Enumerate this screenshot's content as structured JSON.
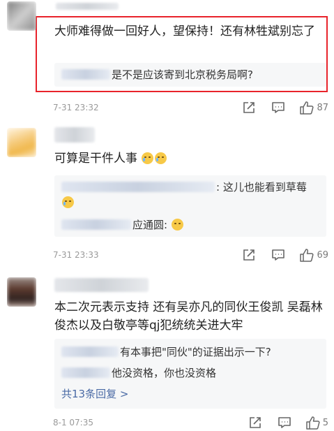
{
  "comments": [
    {
      "text": "大师难得做一回好人，望保持！还有林牲斌别忘了",
      "replies": [
        {
          "suffix": "是不是应该寄到北京税务局啊?"
        }
      ],
      "time": "7-31 23:32",
      "likes": "87"
    },
    {
      "text": "可算是干件人事",
      "replies": [
        {
          "suffix": ": 这儿也能看到草莓"
        },
        {
          "suffix": "应通圆: "
        }
      ],
      "time": "7-31 23:33",
      "likes": "69"
    },
    {
      "text": "本二次元表示支持 还有吴亦凡的同伙王俊凯 吴磊林俊杰以及白敬亭等qj犯统统关进大牢",
      "replies": [
        {
          "suffix": "有本事把\"同伙\"的证据出示一下?"
        },
        {
          "suffix": "他没资格，你也没资格"
        }
      ],
      "more_replies": "共13条回复 >",
      "time": "8-1 07:35",
      "likes": "5"
    }
  ],
  "icons": [
    "share-icon",
    "comment-icon",
    "like-icon"
  ],
  "colors": {
    "highlight": "#e8232b",
    "link": "#4a6aa5",
    "reply_bg": "#f6f7f8"
  }
}
